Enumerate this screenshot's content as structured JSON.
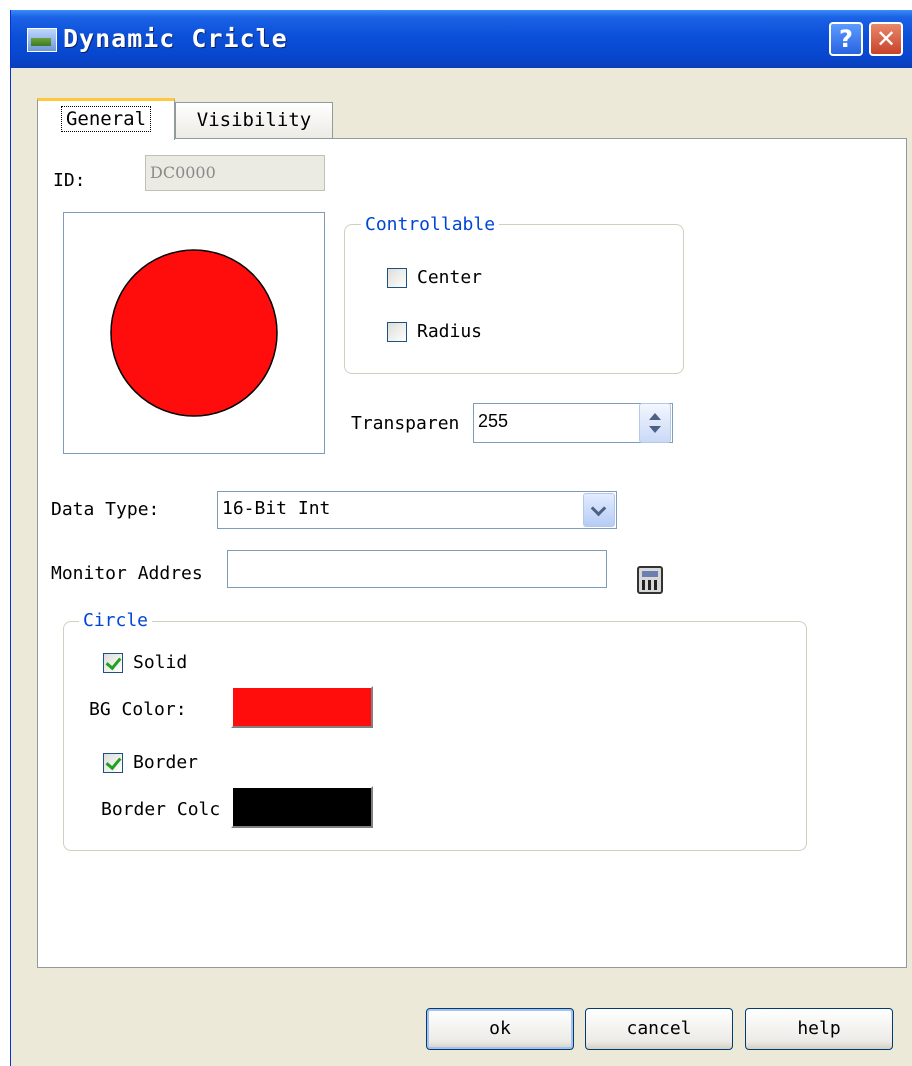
{
  "window": {
    "title": "Dynamic Cricle",
    "help_glyph": "?",
    "close_glyph": "✕"
  },
  "tabs": [
    {
      "label": "General",
      "active": true
    },
    {
      "label": "Visibility",
      "active": false
    }
  ],
  "general": {
    "id_label": "ID:",
    "id_value": "DC0000",
    "preview": {
      "fill_color": "#ff0d0d",
      "border_color": "#000000"
    },
    "controllable": {
      "title": "Controllable",
      "center": {
        "label": "Center",
        "checked": false
      },
      "radius": {
        "label": "Radius",
        "checked": false
      }
    },
    "transparency_label": "Transparen",
    "transparency_value": "255",
    "data_type_label": "Data Type:",
    "data_type_value": "16-Bit Int",
    "monitor_address_label": "Monitor Addres",
    "monitor_address_value": "",
    "circle": {
      "title": "Circle",
      "solid": {
        "label": "Solid",
        "checked": true
      },
      "bg_color_label": "BG Color:",
      "bg_color": "#ff0d0d",
      "border": {
        "label": "Border",
        "checked": true
      },
      "border_color_label": "Border Colc",
      "border_color": "#000000"
    }
  },
  "buttons": {
    "ok": "ok",
    "cancel": "cancel",
    "help": "help"
  }
}
